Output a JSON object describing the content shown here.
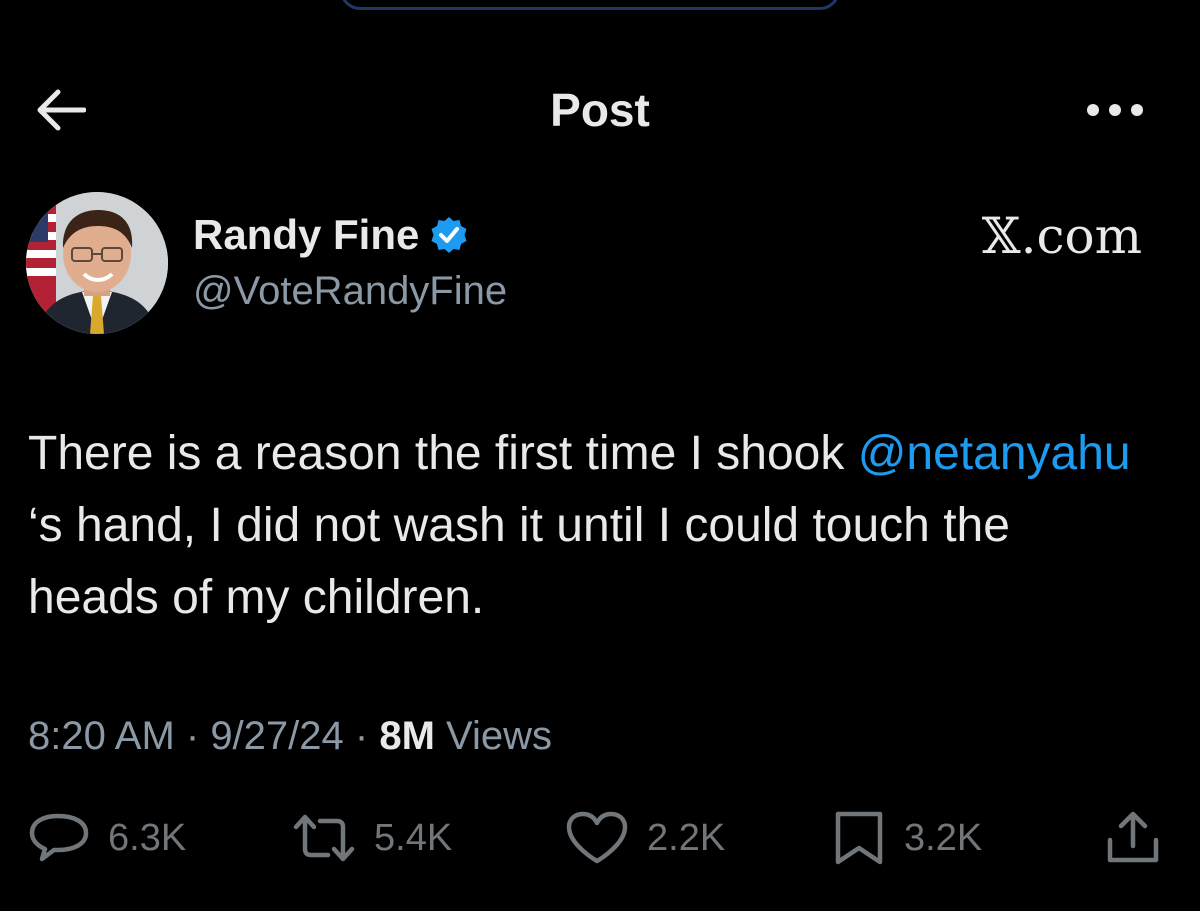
{
  "header": {
    "title": "Post",
    "back_icon": "arrow-left-icon",
    "more_icon": "more-horizontal-icon"
  },
  "post": {
    "author_name": "Randy Fine",
    "author_handle": "@VoteRandyFine",
    "verified_icon": "verified-badge-icon",
    "site_label": "𝕏.com",
    "text_before": "There is a reason the first time I shook ",
    "mention": "@netanyahu",
    "text_after": " ‘s hand, I did not wash it until I could touch the heads of my children.",
    "time": "8:20 AM",
    "date": "9/27/24",
    "views_count": "8M",
    "views_label": "Views"
  },
  "actions": {
    "replies": "6.3K",
    "reposts": "5.4K",
    "likes": "2.2K",
    "bookmarks": "3.2K"
  },
  "colors": {
    "background": "#000000",
    "text": "#e7e9ea",
    "secondary": "#8b98a5",
    "link": "#1d9bf0",
    "verified": "#1d9bf0"
  }
}
